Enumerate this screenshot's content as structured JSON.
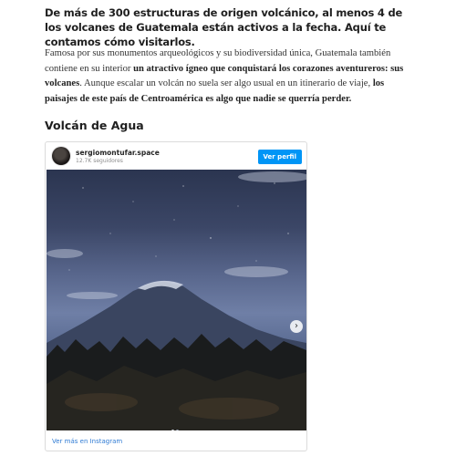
{
  "article": {
    "lede": "De más de 300 estructuras de origen volcánico, al menos 4 de los volcanes de Guatemala están activos a la fecha. Aquí te contamos cómo visitarlos.",
    "paragraph": {
      "part1": "Famosa por sus monumentos arqueológicos y su biodiversidad única, Guatemala también contiene en su interior ",
      "bold1": "un atractivo ígneo que conquistará los corazones aventureros: sus volcanes",
      "part2": ". Aunque escalar un volcán no suela ser algo usual en un itinerario de viaje, ",
      "bold2": "los paisajes de este país de Centroamérica es algo que nadie se querría perder."
    },
    "section_title": "Volcán de Agua"
  },
  "instagram_embed": {
    "username": "sergiomontufar.space",
    "followers": "12.7K seguidores",
    "view_profile_label": "Ver perfil",
    "view_more_label": "Ver más en Instagram",
    "next_icon": "chevron-right-icon",
    "carousel": {
      "current": 1,
      "total": 2
    }
  }
}
